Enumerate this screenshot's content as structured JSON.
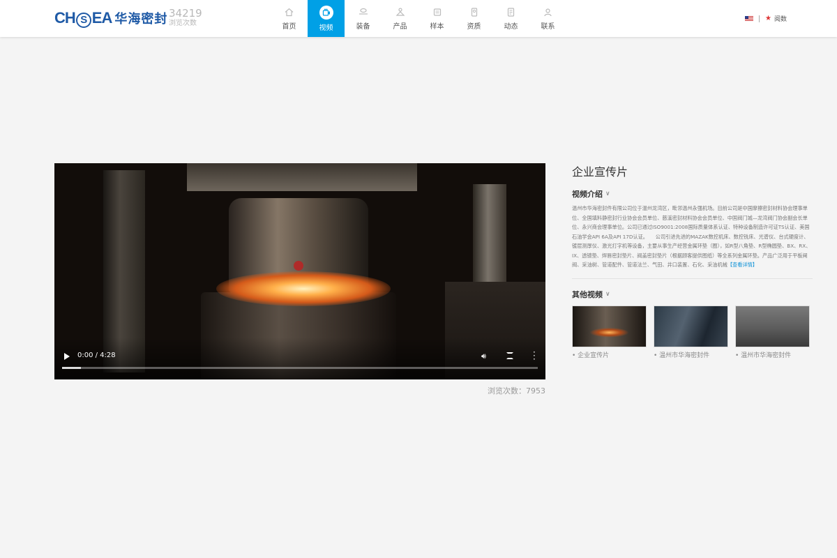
{
  "header": {
    "logo_en_pre": "CH",
    "logo_en_mid": "S",
    "logo_en_post": "EA",
    "logo_cn": "华海密封",
    "visit_count": "34219",
    "visit_label": "浏览次数"
  },
  "nav": {
    "items": [
      {
        "label": "首页",
        "icon": "home-icon"
      },
      {
        "label": "视频",
        "icon": "video-icon"
      },
      {
        "label": "装备",
        "icon": "equipment-icon"
      },
      {
        "label": "产品",
        "icon": "product-icon"
      },
      {
        "label": "样本",
        "icon": "sample-icon"
      },
      {
        "label": "资质",
        "icon": "qualification-icon"
      },
      {
        "label": "动态",
        "icon": "news-icon"
      },
      {
        "label": "联系",
        "icon": "contact-icon"
      }
    ],
    "active": "视频",
    "accent": "#00a0e6"
  },
  "lang": {
    "english_flag": "us-flag-icon",
    "china_label": "阅数"
  },
  "video": {
    "time": "0:00 / 4:28",
    "progress": 0.04,
    "views": "浏览次数：7953"
  },
  "panel": {
    "title": "企业宣传片",
    "intro_heading": "视频介绍",
    "intro_text": "温州市华海密封件有限公司位于温州龙湾区，毗邻温州永强机场。目前公司是中国摩擦密封材料协会理事单位、全国填料静密封行业协会会员单位、慈溪密封材料协会会员单位、中国阀门城—龙湾阀门协会副会长单位、永兴商会理事单位。公司已通过ISO9001:2008国际质量体系认证、特种设备制造许可证TS认证、美国石油学会API 6A及API 17D认证。　　公司引进先进的MAZAK数控机床、数控铣床、光谱仪、台式硬度计、镀层测厚仪、激光打字机等设备，主要从事生产经营金属环垫（圈），如R型八角垫、R型椭圆垫、BX、RX、IX、透镜垫、焊唇密封垫片、阀盖密封垫片（根据顾客提供图纸）等全系列金属环垫。产品广泛用于平板闸阀、采油树、管道配件、管道法兰、气田、井口装置、石化、采油机械",
    "more_link": "【查看详情】",
    "other_heading": "其他视频",
    "thumbs": [
      {
        "caption": "• 企业宣传片"
      },
      {
        "caption": "• 温州市华海密封件"
      },
      {
        "caption": "• 温州市华海密封件"
      }
    ]
  }
}
